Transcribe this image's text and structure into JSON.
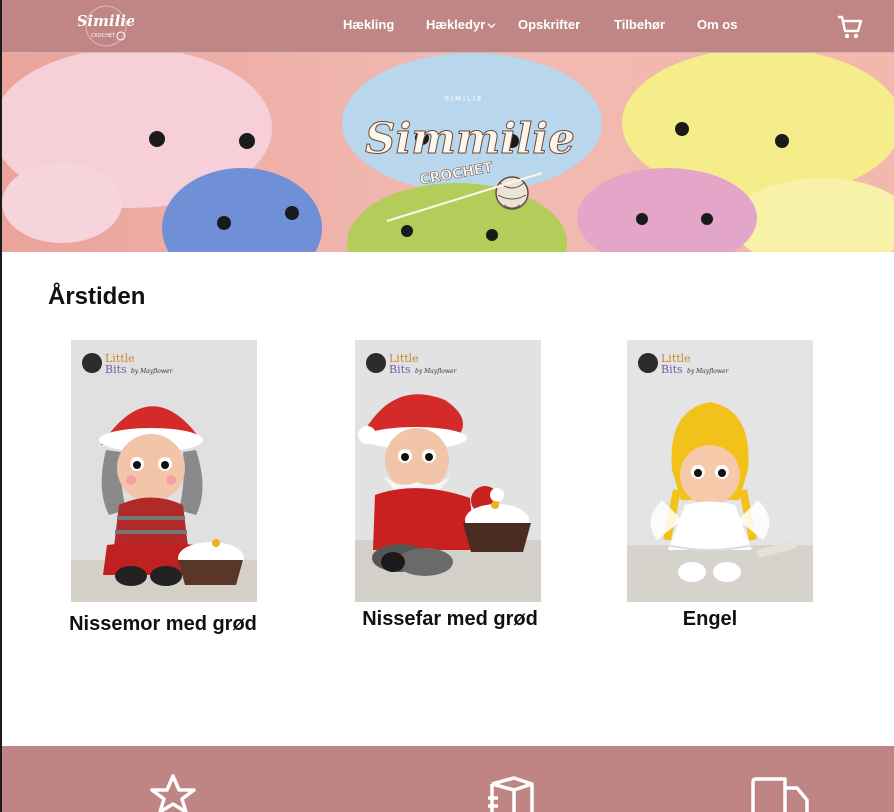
{
  "nav": {
    "logo_text": "Similie",
    "logo_sub": "CROCHET",
    "items": [
      {
        "label": "Hækling",
        "icon": null
      },
      {
        "label": "Hækledyr",
        "icon": "chevron-down-icon"
      },
      {
        "label": "Opskrifter",
        "icon": null
      },
      {
        "label": "Tilbehør",
        "icon": null
      },
      {
        "label": "Om os",
        "icon": null
      }
    ],
    "cart_icon": "cart-icon"
  },
  "hero": {
    "logo_top": "SIMILIE",
    "logo_text": "Simmilie",
    "logo_sub": "CROCHET"
  },
  "section": {
    "title": "Årstiden",
    "products": [
      {
        "title": "Nissemor med grød",
        "brand_line1": "Little",
        "brand_line2": "Bits",
        "brand_by": "by Mayflower"
      },
      {
        "title": "Nissefar med grød",
        "brand_line1": "Little",
        "brand_line2": "Bits",
        "brand_by": "by Mayflower"
      },
      {
        "title": "Engel",
        "brand_line1": "Little",
        "brand_line2": "Bits",
        "brand_by": "by Mayflower"
      }
    ]
  },
  "footer": {
    "icons": [
      "star-icon",
      "box-icon",
      "truck-icon"
    ]
  },
  "colors": {
    "nav_bg": "#c08585",
    "footer_bg": "#bf8484",
    "text": "#111111"
  }
}
